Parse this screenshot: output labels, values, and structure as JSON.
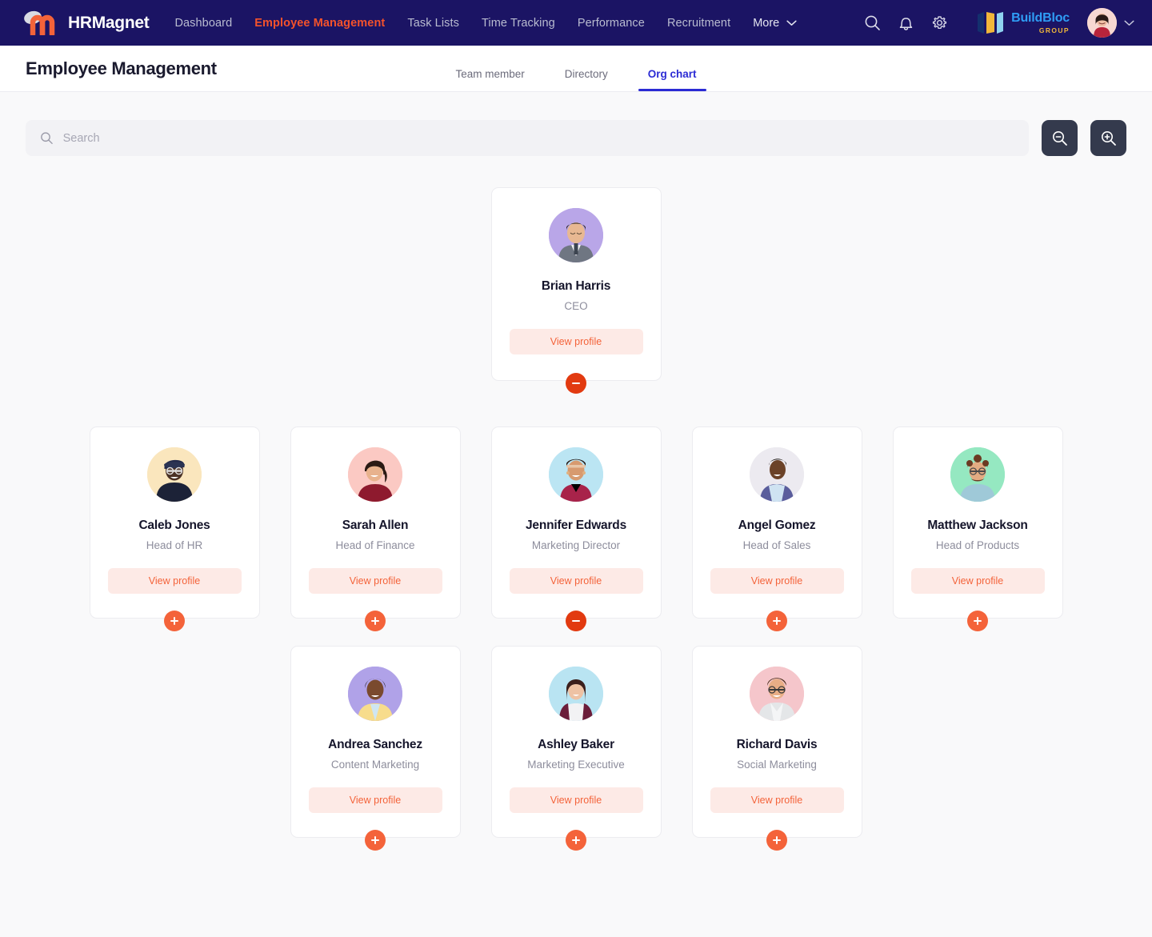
{
  "brand": {
    "name": "HRMagnet",
    "logo_icon": "magnet-m-icon"
  },
  "nav": {
    "links": [
      {
        "label": "Dashboard",
        "active": false
      },
      {
        "label": "Employee Management",
        "active": true
      },
      {
        "label": "Task Lists",
        "active": false
      },
      {
        "label": "Time Tracking",
        "active": false
      },
      {
        "label": "Performance",
        "active": false
      },
      {
        "label": "Recruitment",
        "active": false
      }
    ],
    "more_label": "More",
    "icons": [
      "search-icon",
      "bell-icon",
      "gear-icon"
    ]
  },
  "org_logo": {
    "title": "BuildBloc",
    "subtitle": "GROUP"
  },
  "header": {
    "title": "Employee Management",
    "tabs": [
      {
        "label": "Team member",
        "active": false
      },
      {
        "label": "Directory",
        "active": false
      },
      {
        "label": "Org chart",
        "active": true
      }
    ]
  },
  "toolbar": {
    "search_value": "",
    "search_placeholder": "Search",
    "zoom_out_label": "zoom-out",
    "zoom_in_label": "zoom-in"
  },
  "org_chart": {
    "view_profile_label": "View profile",
    "root": {
      "name": "Brian Harris",
      "role": "CEO",
      "toggle": "minus",
      "avatar_bg": "#b9a6e8"
    },
    "level2": [
      {
        "name": "Caleb Jones",
        "role": "Head of HR",
        "toggle": "plus",
        "avatar_bg": "#fae6bd"
      },
      {
        "name": "Sarah Allen",
        "role": "Head of Finance",
        "toggle": "plus",
        "avatar_bg": "#fbc9c3"
      },
      {
        "name": "Jennifer Edwards",
        "role": "Marketing Director",
        "toggle": "minus",
        "avatar_bg": "#bbe5f3"
      },
      {
        "name": "Angel Gomez",
        "role": "Head of Sales",
        "toggle": "plus",
        "avatar_bg": "#eceaf0"
      },
      {
        "name": "Matthew Jackson",
        "role": "Head of Products",
        "toggle": "plus",
        "avatar_bg": "#95e8c1"
      }
    ],
    "level3": [
      {
        "name": "Andrea Sanchez",
        "role": "Content Marketing",
        "toggle": "plus",
        "avatar_bg": "#b0a2e8"
      },
      {
        "name": "Ashley Baker",
        "role": "Marketing Executive",
        "toggle": "plus",
        "avatar_bg": "#b9e4f2"
      },
      {
        "name": "Richard Davis",
        "role": "Social Marketing",
        "toggle": "plus",
        "avatar_bg": "#f5c6cb"
      }
    ]
  },
  "colors": {
    "nav_bg": "#1b1464",
    "accent_orange": "#f4633a",
    "accent_red": "#e23a10",
    "active_tab": "#2b2bd4",
    "page_bg": "#f9f9fa"
  }
}
